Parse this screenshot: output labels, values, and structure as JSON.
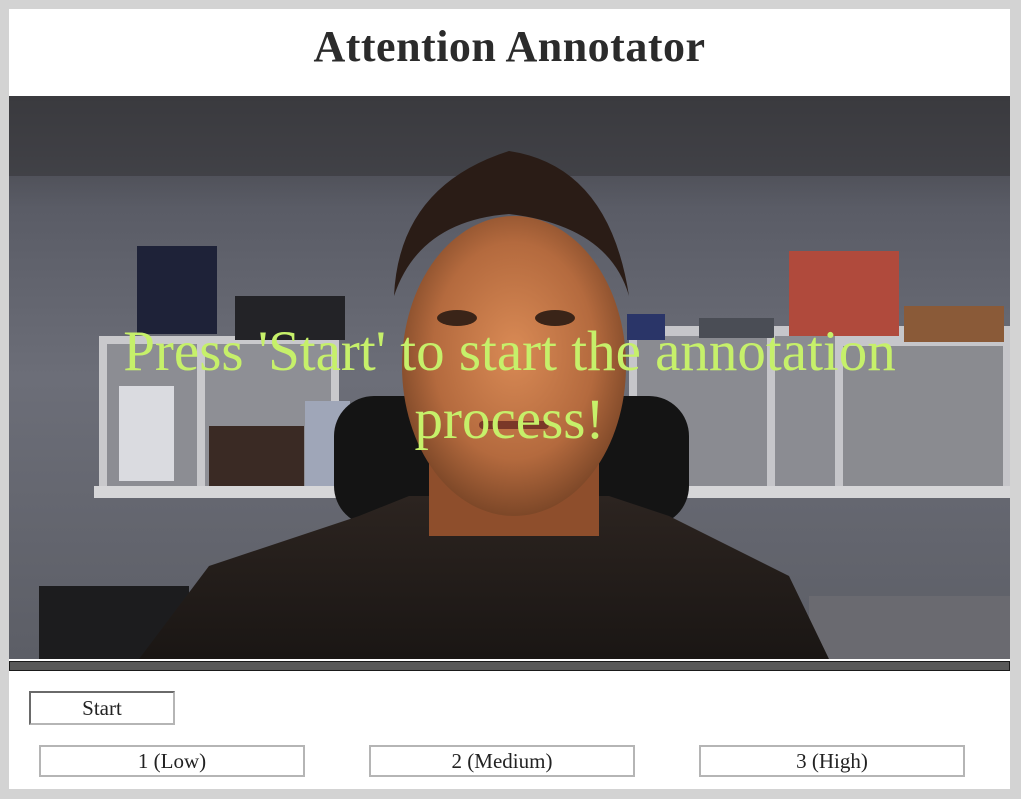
{
  "app": {
    "title": "Attention Annotator"
  },
  "video": {
    "overlay_message": "Press 'Start' to start the annotation process!",
    "progress_fraction": 0.0
  },
  "controls": {
    "start_label": "Start",
    "levels": [
      {
        "label": "1 (Low)"
      },
      {
        "label": "2 (Medium)"
      },
      {
        "label": "3 (High)"
      }
    ]
  },
  "colors": {
    "overlay_text": "#c6f06a",
    "page_border": "#d3d3d3",
    "button_border": "#b5b5b5"
  }
}
